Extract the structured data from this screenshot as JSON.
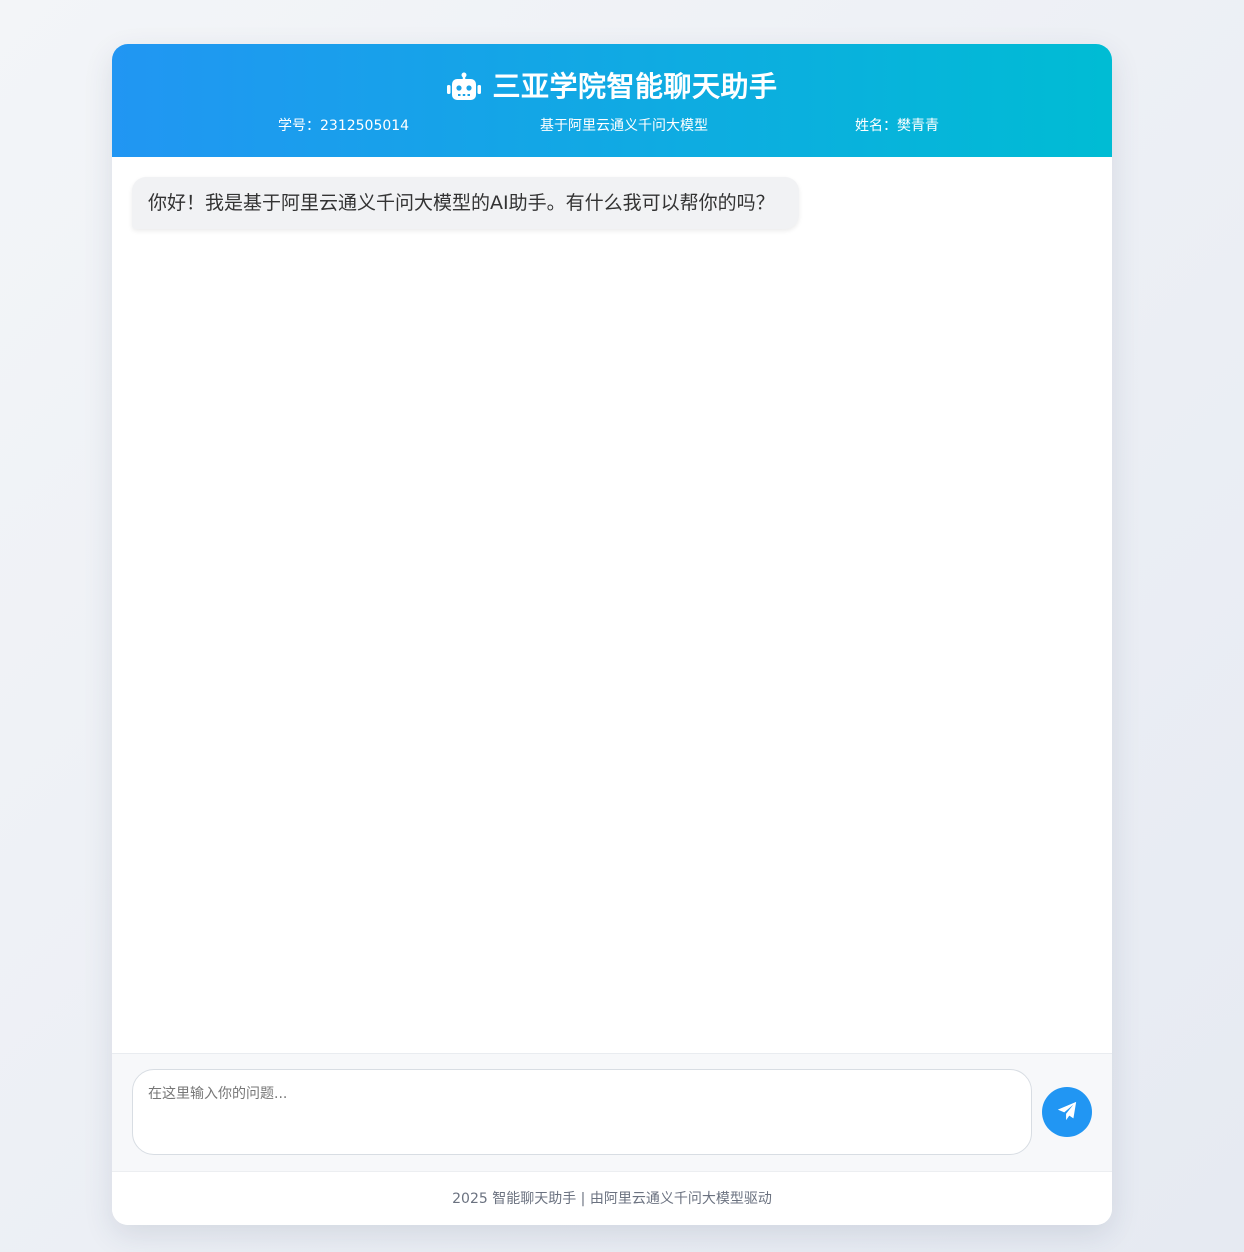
{
  "header": {
    "title": "三亚学院智能聊天助手",
    "icon": "robot-icon",
    "student_id": "学号：2312505014",
    "model_info": "基于阿里云通义千问大模型",
    "student_name": "姓名：樊青青"
  },
  "messages": [
    {
      "role": "assistant",
      "text": "你好！我是基于阿里云通义千问大模型的AI助手。有什么我可以帮你的吗？"
    }
  ],
  "composer": {
    "placeholder": "在这里输入你的问题...",
    "value": "",
    "send_icon": "paper-plane-icon"
  },
  "footer": {
    "text": "2025 智能聊天助手 | 由阿里云通义千问大模型驱动"
  },
  "colors": {
    "header_gradient_start": "#2196f3",
    "header_gradient_end": "#00bcd4",
    "send_button": "#2196f3",
    "bot_bubble": "#f1f2f4"
  }
}
